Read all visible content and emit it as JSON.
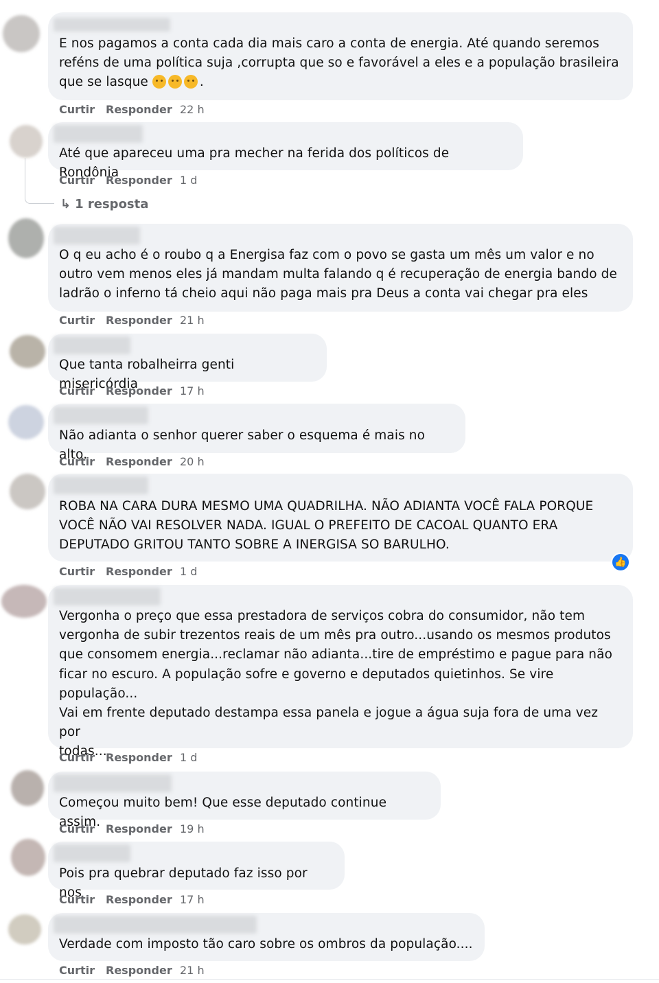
{
  "actions": {
    "like": "Curtir",
    "reply": "Responder"
  },
  "comments": [
    {
      "text": "E nos pagamos a conta cada dia mais caro a conta de energia. Até quando seremos\nreféns de uma política suja ,corrupta que so e favorável a eles e a população brasileira\nque se lasque",
      "emoji": [
        "😔",
        "😔",
        "😔"
      ],
      "after_emoji": ".",
      "time": "22 h"
    },
    {
      "text": "Até que apareceu uma pra mecher na ferida dos políticos de Rondônia",
      "time": "1 d",
      "replies_label": "1 resposta"
    },
    {
      "text": "O q eu acho é o roubo q a Energisa faz com o povo se gasta um mês um valor e no\noutro vem menos eles já mandam multa falando q é recuperação de energia bando de\nladrão o inferno tá cheio aqui não paga mais pra Deus a conta vai chegar pra eles",
      "time": "21 h"
    },
    {
      "text": "Que tanta robalheirra genti misericórdia",
      "time": "17 h"
    },
    {
      "text": "Não adianta o senhor querer saber o esquema é mais no alto.",
      "time": "20 h"
    },
    {
      "text": "ROBA NA CARA DURA MESMO UMA QUADRILHA. NÃO ADIANTA VOCÊ FALA PORQUE\nVOCÊ NÃO VAI RESOLVER NADA. IGUAL O PREFEITO DE CACOAL QUANTO ERA\nDEPUTADO GRITOU TANTO SOBRE A INERGISA SO BARULHO.",
      "time": "1 d",
      "reaction": "like-icon"
    },
    {
      "text": "Vergonha o preço que essa prestadora de serviços cobra do consumidor, não tem\nvergonha de subir trezentos reais de um mês pra outro...usando os mesmos produtos\nque consomem energia...reclamar não adianta...tire de empréstimo e pague para não\nficar no escuro. A população sofre e governo e deputados quietinhos. Se vire\npopulação...\nVai em frente deputado destampa essa panela e jogue a água suja fora de uma vez por\ntodas...",
      "time": "1 d"
    },
    {
      "text": "Começou muito bem! Que esse deputado continue assim.",
      "time": "19 h"
    },
    {
      "text": "Pois pra quebrar deputado faz isso por nos",
      "time": "17 h"
    },
    {
      "text": "Verdade com imposto tão caro sobre os ombros da população....",
      "time": "21 h"
    }
  ]
}
